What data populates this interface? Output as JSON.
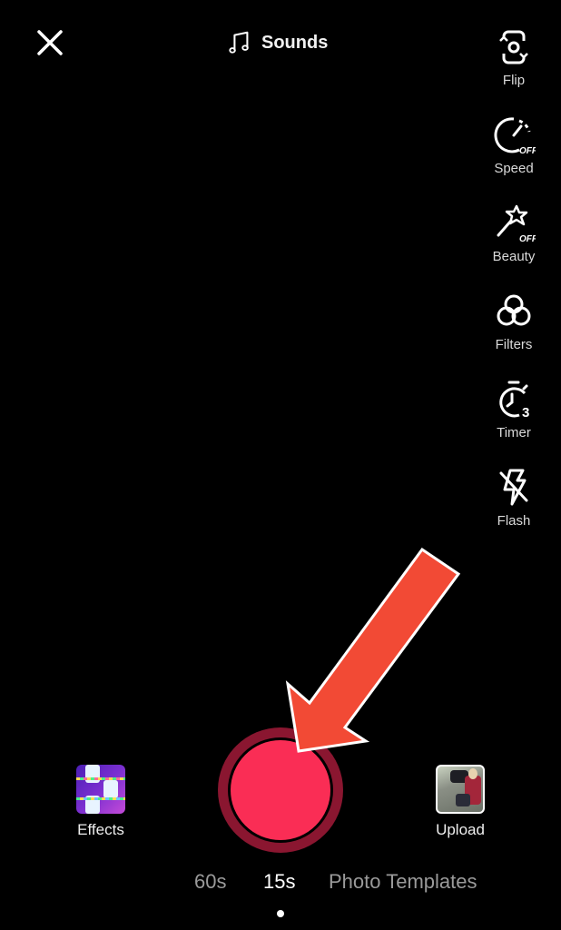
{
  "top_bar": {
    "close_icon": "close-icon",
    "sounds_icon": "music-note-icon",
    "sounds_label": "Sounds"
  },
  "side_tools": [
    {
      "icon": "flip-camera-icon",
      "label": "Flip"
    },
    {
      "icon": "speed-icon",
      "label": "Speed",
      "badge": "OFF"
    },
    {
      "icon": "beauty-wand-icon",
      "label": "Beauty",
      "badge": "OFF"
    },
    {
      "icon": "filters-icon",
      "label": "Filters"
    },
    {
      "icon": "timer-icon",
      "label": "Timer",
      "badge": "3"
    },
    {
      "icon": "flash-off-icon",
      "label": "Flash"
    }
  ],
  "bottom": {
    "effects_label": "Effects",
    "upload_label": "Upload",
    "record_color": "#fa2d55",
    "record_ring_color": "#8a1630"
  },
  "modes": [
    {
      "label": "60s",
      "active": false
    },
    {
      "label": "15s",
      "active": true
    },
    {
      "label": "Photo Templates",
      "active": false
    }
  ],
  "annotation": {
    "arrow_color": "#f24a35",
    "arrow_outline": "#ffffff",
    "points_to": "record-button"
  }
}
